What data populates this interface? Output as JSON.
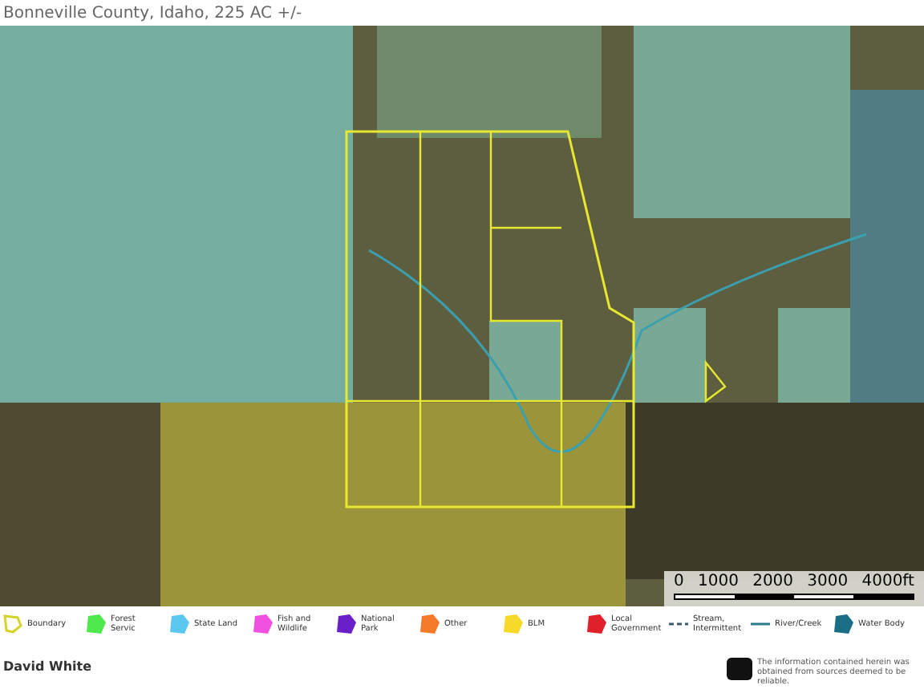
{
  "header": {
    "subtitle": "Bonneville County, Idaho, 225 AC +/-"
  },
  "scale_bar": {
    "labels": [
      "0",
      "1000",
      "2000",
      "3000",
      "4000ft"
    ]
  },
  "legend": [
    {
      "kind": "outline",
      "label": "Boundary",
      "color": "#d4d42a"
    },
    {
      "kind": "area",
      "label": "Forest Servic",
      "color": "#4de94d"
    },
    {
      "kind": "area",
      "label": "State Land",
      "color": "#5cc8f0"
    },
    {
      "kind": "area",
      "label": "Fish and Wildlife",
      "color": "#f050e0"
    },
    {
      "kind": "area",
      "label": "National Park",
      "color": "#6a1fc8"
    },
    {
      "kind": "area",
      "label": "Other",
      "color": "#f57a2a"
    },
    {
      "kind": "area",
      "label": "BLM",
      "color": "#f7d92a"
    },
    {
      "kind": "area",
      "label": "Local Government",
      "color": "#e0202a"
    },
    {
      "kind": "dashed",
      "label": "Stream, Intermittent",
      "color": "#3a5a6a"
    },
    {
      "kind": "line",
      "label": "River/Creek",
      "color": "#2a7a8a"
    },
    {
      "kind": "area",
      "label": "Water Body",
      "color": "#1a6e86"
    }
  ],
  "footer": {
    "name": "David White",
    "disclaimer": "The information contained herein was obtained from sources deemed to be reliable."
  }
}
